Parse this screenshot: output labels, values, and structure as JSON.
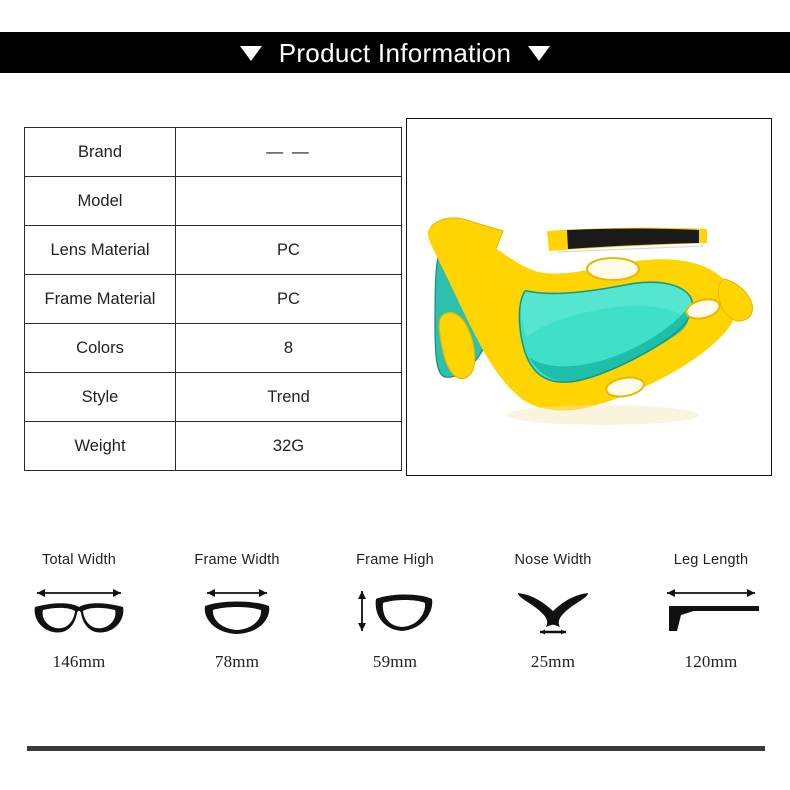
{
  "header": {
    "title": "Product Information",
    "left_marker": "triangle-down",
    "right_marker": "triangle-down",
    "background_color": "#000000",
    "text_color": "#ffffff"
  },
  "spec_table": {
    "rows": [
      {
        "label": "Brand",
        "value": "— —"
      },
      {
        "label": "Model",
        "value": ""
      },
      {
        "label": "Lens Material",
        "value": "PC"
      },
      {
        "label": "Frame Material",
        "value": "PC"
      },
      {
        "label": "Colors",
        "value": "8"
      },
      {
        "label": "Style",
        "value": "Trend"
      },
      {
        "label": "Weight",
        "value": "32G"
      }
    ]
  },
  "product_image": {
    "alt": "yellow-sport-sunglasses-with-turquoise-mirrored-lens",
    "frame_color": "#FFD400",
    "frame_shadow_color": "#E8B400",
    "lens_color": "#3FE0C8",
    "lens_edge_color": "#12B9A6",
    "tip_color": "#1a1a1a",
    "background_color": "#ffffff"
  },
  "measurements": [
    {
      "title": "Total Width",
      "value": "146mm",
      "icon": "full-frame-horizontal-arrow-icon"
    },
    {
      "title": "Frame Width",
      "value": "78mm",
      "icon": "single-lens-horizontal-arrow-icon"
    },
    {
      "title": "Frame High",
      "value": "59mm",
      "icon": "single-lens-vertical-arrow-icon"
    },
    {
      "title": "Nose Width",
      "value": "25mm",
      "icon": "nose-bridge-arrow-icon"
    },
    {
      "title": "Leg Length",
      "value": "120mm",
      "icon": "temple-arm-horizontal-arrow-icon"
    }
  ],
  "footer": {
    "rule_color": "#3b3b3b"
  }
}
